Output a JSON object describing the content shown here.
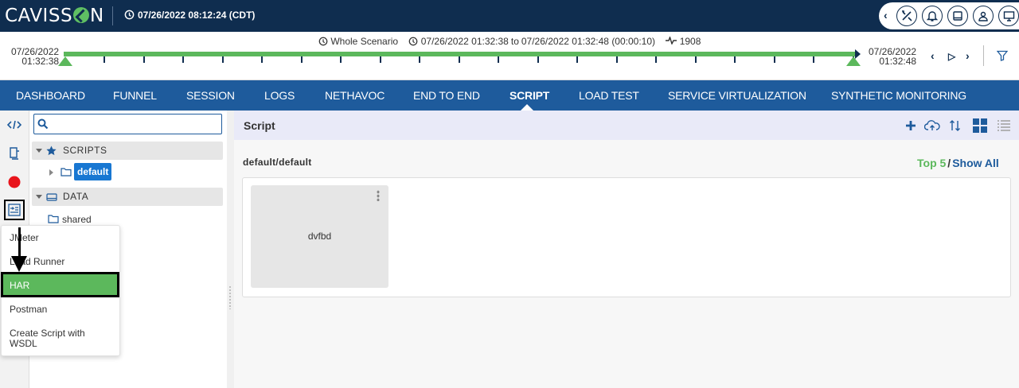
{
  "header": {
    "logo_text": "CAVISS",
    "logo_suffix": "N",
    "datetime": "07/26/2022 08:12:24 (CDT)",
    "tool_icons": [
      "tools-icon",
      "bell-icon",
      "tablet-icon",
      "user-icon",
      "monitor-icon"
    ]
  },
  "timeline": {
    "scenario": "Whole Scenario",
    "range_start": "07/26/2022 01:32:38",
    "range_to": "to",
    "range_end": "07/26/2022 01:32:48 (00:00:10)",
    "count": "1908",
    "left_date": "07/26/2022",
    "left_time": "01:32:38",
    "right_date": "07/26/2022",
    "right_time": "01:32:48"
  },
  "nav": {
    "items": [
      "DASHBOARD",
      "FUNNEL",
      "SESSION",
      "LOGS",
      "NETHAVOC",
      "END TO END",
      "SCRIPT",
      "LOAD TEST",
      "SERVICE VIRTUALIZATION",
      "SYNTHETIC MONITORING"
    ],
    "active": "SCRIPT"
  },
  "tree": {
    "search_placeholder": "",
    "scripts_label": "SCRIPTS",
    "scripts_child": "default",
    "data_label": "DATA",
    "data_child": "shared"
  },
  "menu": {
    "items": [
      "JMeter",
      "Load Runner",
      "HAR",
      "Postman",
      "Create Script with WSDL"
    ],
    "highlighted": "HAR"
  },
  "main": {
    "title": "Script",
    "path": "default/default",
    "top5": "Top 5",
    "slash": "/",
    "show_all": "Show All",
    "cards": [
      "dvfbd"
    ]
  },
  "colors": {
    "header_bg": "#0f2d4f",
    "nav_bg": "#1e5b9c",
    "accent_green": "#5cb85c",
    "badge_blue": "#1877d2",
    "main_head_bg": "#e9eaf8"
  }
}
